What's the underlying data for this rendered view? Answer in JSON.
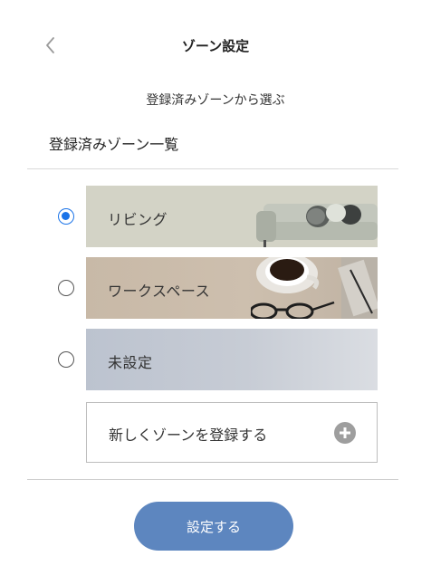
{
  "header": {
    "back_icon": "chevron-left-icon",
    "title": "ゾーン設定"
  },
  "subtitle": "登録済みゾーンから選ぶ",
  "section_heading": "登録済みゾーン一覧",
  "zones": [
    {
      "label": "リビング",
      "selected": true,
      "image": "sofa-illustration"
    },
    {
      "label": "ワークスペース",
      "selected": false,
      "image": "coffee-desk-illustration"
    },
    {
      "label": "未設定",
      "selected": false,
      "image": "none"
    }
  ],
  "add_zone": {
    "label": "新しくゾーンを登録する",
    "icon": "plus-circle-icon"
  },
  "submit_button": {
    "label": "設定する"
  },
  "colors": {
    "accent": "#5d86bf",
    "radio_selected": "#1a73e8",
    "living_bg": "#d3d3c6",
    "workspace_bg": "#c8b9a7",
    "unset_bg": "#bcc3cf"
  }
}
